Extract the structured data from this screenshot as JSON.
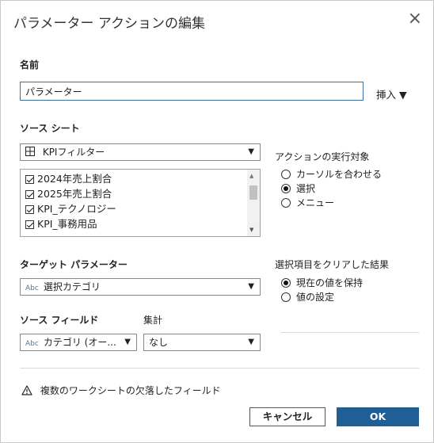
{
  "dialog": {
    "title": "パラメーター アクションの編集",
    "close_glyph": "×"
  },
  "name_section": {
    "label": "名前",
    "value": "パラメーター",
    "insert_label": "挿入 ▼"
  },
  "source_sheets": {
    "label": "ソース シート",
    "selected": "KPIフィルター",
    "items": [
      {
        "label": "2024年売上割合",
        "checked": true
      },
      {
        "label": "2025年売上割合",
        "checked": true
      },
      {
        "label": "KPI_テクノロジー",
        "checked": true
      },
      {
        "label": "KPI_事務用品",
        "checked": true
      }
    ]
  },
  "run_action_on": {
    "label": "アクションの実行対象",
    "options": [
      "カーソルを合わせる",
      "選択",
      "メニュー"
    ],
    "selected_index": 1
  },
  "target_parameter": {
    "label": "ターゲット パラメーター",
    "type_badge": "Abc",
    "value": "選択カテゴリ"
  },
  "clearing_selection": {
    "label": "選択項目をクリアした結果",
    "options": [
      "現在の値を保持",
      "値の設定"
    ],
    "selected_index": 0
  },
  "source_field": {
    "label": "ソース フィールド",
    "type_badge": "Abc",
    "value": "カテゴリ (オー..."
  },
  "aggregation": {
    "label": "集計",
    "value": "なし"
  },
  "warning": {
    "text": "複数のワークシートの欠落したフィールド"
  },
  "buttons": {
    "cancel": "キャンセル",
    "ok": "OK"
  },
  "colors": {
    "accent": "#1f5f95",
    "input_border": "#3a6ea5"
  }
}
